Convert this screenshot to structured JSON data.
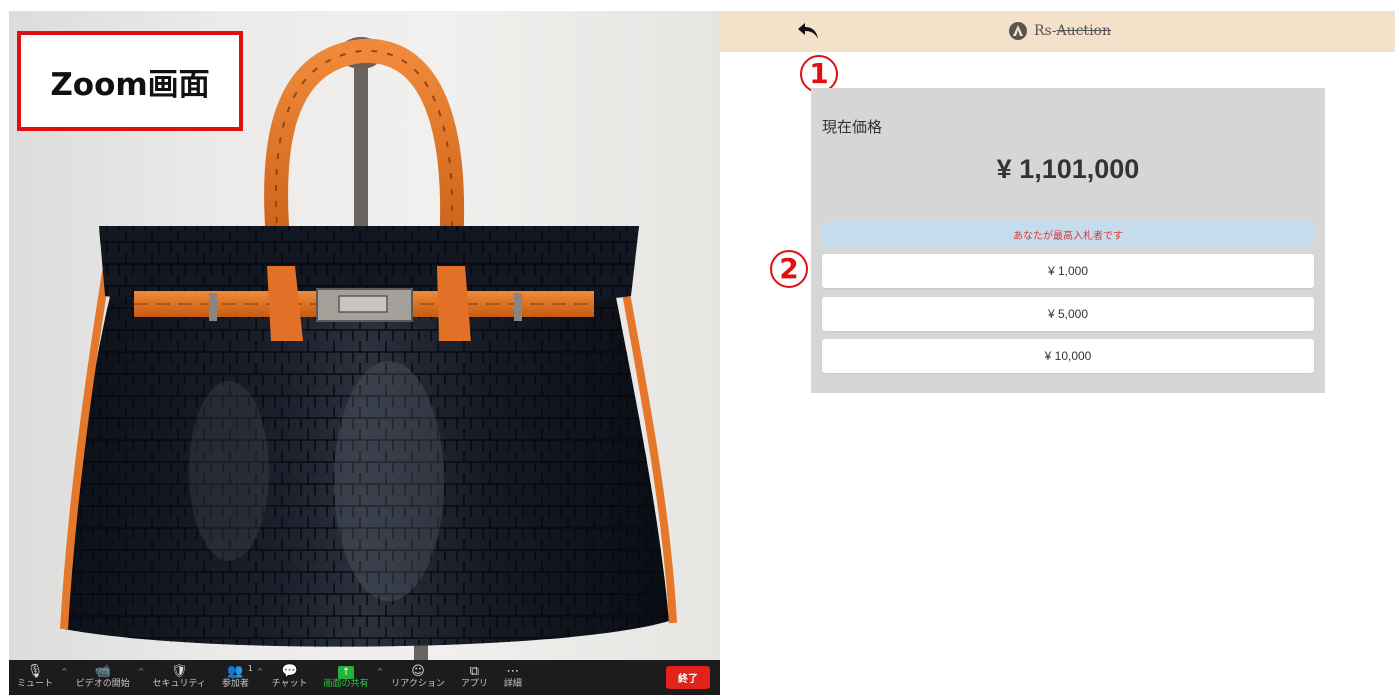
{
  "zoom": {
    "label": "Zoom画面",
    "toolbar": {
      "items": [
        {
          "name": "mute",
          "icon": "microphone-icon",
          "glyph": "🎙",
          "label": "ミュート",
          "caret": true
        },
        {
          "name": "video",
          "icon": "video-off-icon",
          "glyph": "📹",
          "label": "ビデオの開始",
          "caret": true
        },
        {
          "name": "security",
          "icon": "shield-icon",
          "glyph": "🛡",
          "label": "セキュリティ",
          "caret": false
        },
        {
          "name": "participants",
          "icon": "participants-icon",
          "glyph": "👥",
          "label": "参加者",
          "caret": true,
          "count": "1"
        },
        {
          "name": "chat",
          "icon": "chat-icon",
          "glyph": "💬",
          "label": "チャット",
          "caret": false
        },
        {
          "name": "share",
          "icon": "share-screen-icon",
          "glyph": "↑",
          "label": "画面の共有",
          "caret": true
        },
        {
          "name": "reaction",
          "icon": "emoji-icon",
          "glyph": "☺",
          "label": "リアクション",
          "caret": false
        },
        {
          "name": "apps",
          "icon": "apps-icon",
          "glyph": "⧉",
          "label": "アプリ",
          "caret": false
        },
        {
          "name": "more",
          "icon": "more-icon",
          "glyph": "⋯",
          "label": "詳細",
          "caret": false
        }
      ],
      "end_label": "終了"
    }
  },
  "app": {
    "brand_prefix": "Rs-",
    "brand_strike": "Auction",
    "back_icon": "back-arrow-icon",
    "logo_icon": "rs-logo-icon"
  },
  "markers": {
    "one": "1",
    "two": "2"
  },
  "auction": {
    "current_price_label": "現在価格",
    "current_price": "¥ 1,101,000",
    "highest_bidder_notice": "あなたが最高入札者です",
    "bid_increments": [
      "¥ 1,000",
      "¥ 5,000",
      "¥ 10,000"
    ]
  },
  "colors": {
    "appbar": "#f4e1c9",
    "card": "#d6d6d6",
    "notice_bg": "#c5dcec",
    "notice_text": "#d33a3a",
    "marker": "#e01010",
    "share_green": "#23b33d",
    "end_red": "#e0241b"
  }
}
